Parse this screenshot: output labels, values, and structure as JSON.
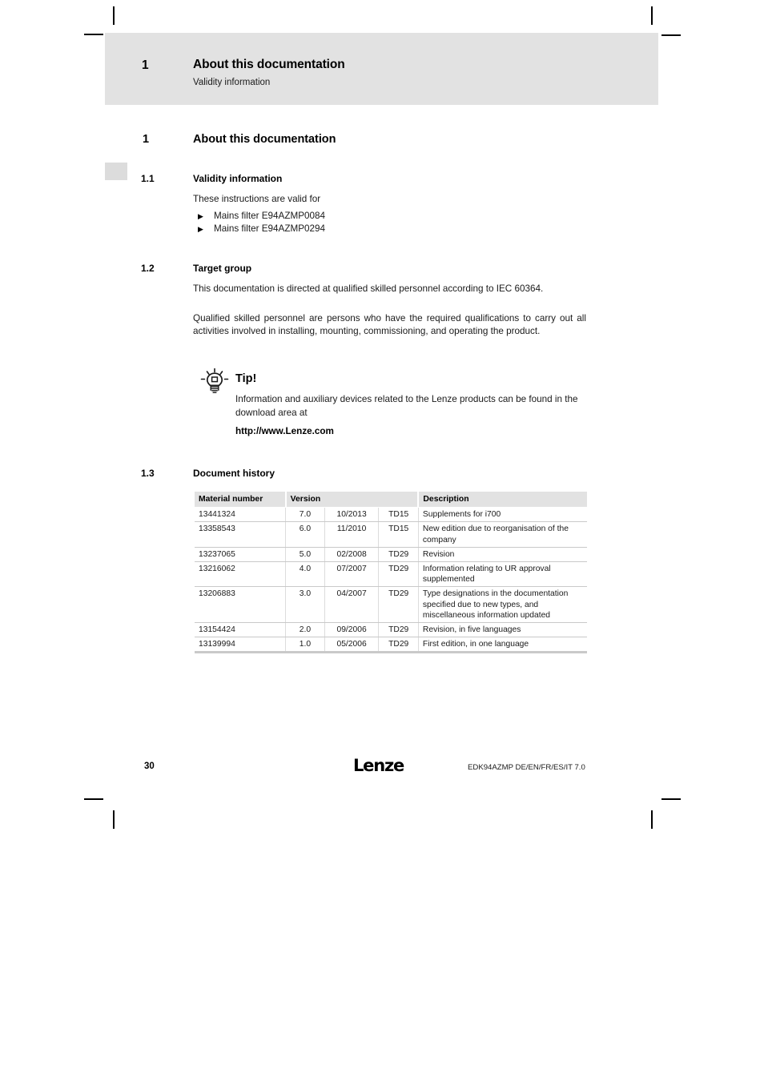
{
  "page": {
    "number": "30",
    "footer_doc_code": "EDK94AZMP  DE/EN/FR/ES/IT  7.0",
    "logo_text": "Lenze"
  },
  "running_header": {
    "chapter_number": "1",
    "chapter_title": "About this documentation",
    "subtitle": "Validity information"
  },
  "chapter": {
    "number": "1",
    "title": "About this documentation"
  },
  "sections": {
    "validity": {
      "number": "1.1",
      "title": "Validity information",
      "intro": "These instructions are valid for",
      "bullets": [
        "Mains filter E94AZMP0084",
        "Mains filter E94AZMP0294"
      ],
      "bullet_glyph": "▶"
    },
    "target_group": {
      "number": "1.2",
      "title": "Target group",
      "paragraph1": "This documentation is directed at qualified skilled personnel according to IEC 60364.",
      "paragraph2": "Qualified skilled personnel are persons who have the required qualifications to carry out all activities involved in installing, mounting, commissioning, and operating the product."
    },
    "document_history": {
      "number": "1.3",
      "title": "Document history"
    }
  },
  "tip": {
    "icon": "lightbulb-icon",
    "title": "Tip!",
    "body": "Information and auxiliary devices related to the Lenze products can be found in the download area at",
    "link": "http://www.Lenze.com"
  },
  "history_table": {
    "headers": {
      "material_number": "Material number",
      "version": "Version",
      "description": "Description"
    },
    "rows": [
      {
        "material_number": "13441324",
        "version": "7.0",
        "date": "10/2013",
        "code": "TD15",
        "description": "Supplements for i700"
      },
      {
        "material_number": "13358543",
        "version": "6.0",
        "date": "11/2010",
        "code": "TD15",
        "description": "New edition due to reorganisation of the company"
      },
      {
        "material_number": "13237065",
        "version": "5.0",
        "date": "02/2008",
        "code": "TD29",
        "description": "Revision"
      },
      {
        "material_number": "13216062",
        "version": "4.0",
        "date": "07/2007",
        "code": "TD29",
        "description": "Information relating to UR approval supplemented"
      },
      {
        "material_number": "13206883",
        "version": "3.0",
        "date": "04/2007",
        "code": "TD29",
        "description": "Type designations in the documentation specified due to new types, and miscellaneous information updated"
      },
      {
        "material_number": "13154424",
        "version": "2.0",
        "date": "09/2006",
        "code": "TD29",
        "description": "Revision, in five languages"
      },
      {
        "material_number": "13139994",
        "version": "1.0",
        "date": "05/2006",
        "code": "TD29",
        "description": "First edition, in one language"
      }
    ]
  },
  "colors": {
    "header_band": "#e2e2e2",
    "table_header": "#e2e2e2",
    "chapter_tab": "#dcdcdc",
    "text": "#1a1a1a"
  }
}
